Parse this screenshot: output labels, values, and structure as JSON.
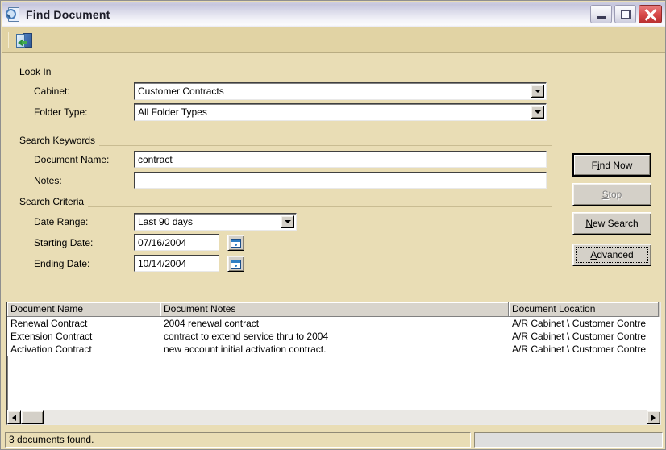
{
  "window": {
    "title": "Find Document",
    "title_icon": "find-document-icon",
    "buttons": {
      "minimize": "minimize-button",
      "maximize": "maximize-button",
      "close": "close-button"
    }
  },
  "toolbar": {
    "items": [
      {
        "name": "retrieve-document-button",
        "icon": "open-document-retrieve-icon"
      }
    ]
  },
  "look_in": {
    "group_label": "Look In",
    "cabinet": {
      "label": "Cabinet:",
      "value": "Customer Contracts"
    },
    "folder_type": {
      "label": "Folder Type:",
      "value": "All Folder Types"
    }
  },
  "search_keywords": {
    "group_label": "Search Keywords",
    "document_name": {
      "label": "Document Name:",
      "value": "contract"
    },
    "notes": {
      "label": "Notes:",
      "value": ""
    }
  },
  "search_criteria": {
    "group_label": "Search Criteria",
    "date_range": {
      "label": "Date Range:",
      "value": "Last 90 days"
    },
    "starting_date": {
      "label": "Starting Date:",
      "value": "07/16/2004",
      "picker_icon": "calendar-icon"
    },
    "ending_date": {
      "label": "Ending Date:",
      "value": "10/14/2004",
      "picker_icon": "calendar-icon"
    }
  },
  "actions": {
    "find_now": {
      "pre": "F",
      "mnemonic": "i",
      "post": "nd Now",
      "state": "default"
    },
    "stop": {
      "pre": "",
      "mnemonic": "S",
      "post": "top",
      "state": "disabled"
    },
    "new_search": {
      "pre": "",
      "mnemonic": "N",
      "post": "ew Search",
      "state": "normal"
    },
    "advanced": {
      "pre": "",
      "mnemonic": "A",
      "post": "dvanced",
      "state": "focused"
    }
  },
  "results": {
    "columns": [
      "Document Name",
      "Document Notes",
      "Document Location"
    ],
    "rows": [
      {
        "name": "Renewal Contract",
        "notes": "2004 renewal contract",
        "location": "A/R Cabinet \\ Customer Contre"
      },
      {
        "name": "Extension Contract",
        "notes": "contract to extend service thru to 2004",
        "location": "A/R Cabinet \\ Customer Contre"
      },
      {
        "name": "Activation Contract",
        "notes": "new account initial activation contract.",
        "location": "A/R Cabinet \\ Customer Contre"
      }
    ],
    "scrollbar": {
      "left_arrow": "scroll-left-arrow-icon",
      "right_arrow": "scroll-right-arrow-icon"
    }
  },
  "statusbar": {
    "message": "3 documents found.",
    "aux": ""
  },
  "colors": {
    "form_background": "#e9ddb5",
    "toolbar_background": "#e1d3a4",
    "control_face": "#d4d0c8",
    "close_button": "#b93030",
    "field_background": "#ffffff"
  }
}
